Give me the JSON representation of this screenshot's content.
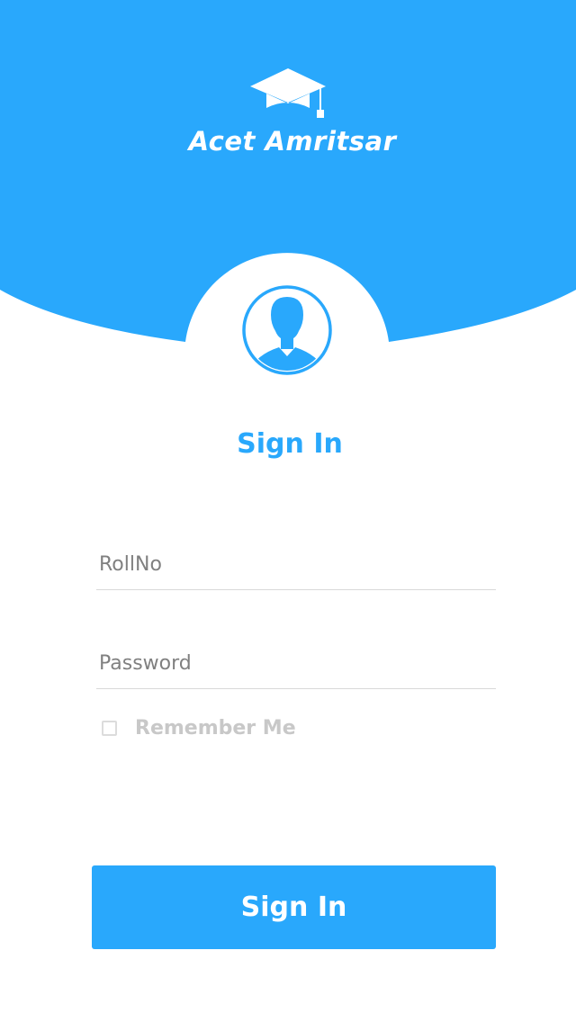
{
  "brand": {
    "app_name": "Acet Amritsar",
    "logo_icon": "graduation-cap-icon",
    "avatar_icon": "user-avatar-icon"
  },
  "colors": {
    "primary": "#29a8fc",
    "background": "#ffffff"
  },
  "form": {
    "heading": "Sign In",
    "rollno_placeholder": "RollNo",
    "rollno_value": "",
    "password_placeholder": "Password",
    "password_value": "",
    "remember_label": "Remember Me",
    "remember_checked": false,
    "submit_label": "Sign In"
  }
}
